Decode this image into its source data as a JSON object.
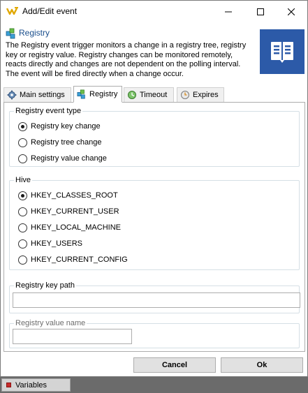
{
  "window": {
    "title": "Add/Edit event",
    "controls": [
      "minimize-icon",
      "maximize-icon",
      "close-icon"
    ]
  },
  "header": {
    "heading": "Registry",
    "description": "The Registry event trigger monitors a change in a registry tree, registry key or registry value. Registry changes can be monitored remotely, reacts directly and changes are not dependent on the polling interval. The event will be fired directly when a change occur.",
    "icon": "document-lines-icon",
    "accent": "#2c5aa8"
  },
  "tabs": [
    {
      "label": "Main settings",
      "icon": "gear-icon"
    },
    {
      "label": "Registry",
      "icon": "registry-icon",
      "active": true
    },
    {
      "label": "Timeout",
      "icon": "timeout-icon"
    },
    {
      "label": "Expires",
      "icon": "clock-icon"
    }
  ],
  "registry_event_type": {
    "legend": "Registry event type",
    "options": [
      "Registry key change",
      "Registry tree change",
      "Registry value change"
    ],
    "selected": "Registry key change"
  },
  "hive": {
    "legend": "Hive",
    "options": [
      "HKEY_CLASSES_ROOT",
      "HKEY_CURRENT_USER",
      "HKEY_LOCAL_MACHINE",
      "HKEY_USERS",
      "HKEY_CURRENT_CONFIG"
    ],
    "selected": "HKEY_CLASSES_ROOT"
  },
  "registry_key_path": {
    "legend": "Registry key path",
    "value": ""
  },
  "registry_value_name": {
    "legend": "Registry value name",
    "value": ""
  },
  "buttons": {
    "cancel": "Cancel",
    "ok": "Ok"
  },
  "taskbar": {
    "item": "Variables"
  }
}
